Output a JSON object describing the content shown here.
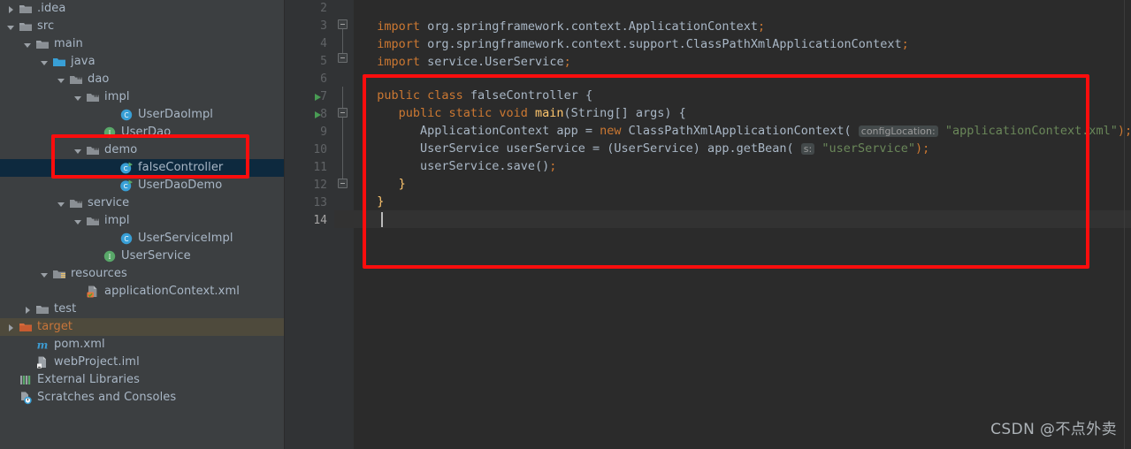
{
  "window": {
    "theme_bg": "#3c3f41",
    "editor_bg": "#2b2b2b",
    "accent_red": "#fb0d0d",
    "selection_bg": "#0d293e",
    "excluded_bg": "#4e4a3c"
  },
  "sidebar": {
    "name": "project-tree",
    "items": [
      {
        "label": ".idea",
        "indent": 0,
        "arrow": "collapsed",
        "icon": "folder-icon",
        "state": "normal"
      },
      {
        "label": "src",
        "indent": 0,
        "arrow": "expanded",
        "icon": "folder-icon",
        "state": "normal"
      },
      {
        "label": "main",
        "indent": 1,
        "arrow": "expanded",
        "icon": "folder-icon",
        "state": "normal"
      },
      {
        "label": "java",
        "indent": 2,
        "arrow": "expanded",
        "icon": "source-root-icon",
        "state": "normal"
      },
      {
        "label": "dao",
        "indent": 3,
        "arrow": "expanded",
        "icon": "package-icon",
        "state": "normal"
      },
      {
        "label": "impl",
        "indent": 4,
        "arrow": "expanded",
        "icon": "package-icon",
        "state": "normal"
      },
      {
        "label": "UserDaoImpl",
        "indent": 6,
        "arrow": "none",
        "icon": "java-class-icon",
        "state": "normal"
      },
      {
        "label": "UserDao",
        "indent": 5,
        "arrow": "none",
        "icon": "java-interface-icon",
        "state": "normal"
      },
      {
        "label": "demo",
        "indent": 4,
        "arrow": "expanded",
        "icon": "package-icon",
        "state": "normal"
      },
      {
        "label": "falseController",
        "indent": 6,
        "arrow": "none",
        "icon": "java-runnable-class-icon",
        "state": "selected"
      },
      {
        "label": "UserDaoDemo",
        "indent": 6,
        "arrow": "none",
        "icon": "java-runnable-class-icon",
        "state": "normal"
      },
      {
        "label": "service",
        "indent": 3,
        "arrow": "expanded",
        "icon": "package-icon",
        "state": "normal"
      },
      {
        "label": "impl",
        "indent": 4,
        "arrow": "expanded",
        "icon": "package-icon",
        "state": "normal"
      },
      {
        "label": "UserServiceImpl",
        "indent": 6,
        "arrow": "none",
        "icon": "java-class-icon",
        "state": "normal"
      },
      {
        "label": "UserService",
        "indent": 5,
        "arrow": "none",
        "icon": "java-interface-icon",
        "state": "normal"
      },
      {
        "label": "resources",
        "indent": 2,
        "arrow": "expanded",
        "icon": "resource-root-icon",
        "state": "normal"
      },
      {
        "label": "applicationContext.xml",
        "indent": 4,
        "arrow": "none",
        "icon": "spring-xml-icon",
        "state": "normal"
      },
      {
        "label": "test",
        "indent": 1,
        "arrow": "collapsed",
        "icon": "folder-icon",
        "state": "normal"
      },
      {
        "label": "target",
        "indent": 0,
        "arrow": "collapsed",
        "icon": "excluded-folder-icon",
        "state": "excluded"
      },
      {
        "label": "pom.xml",
        "indent": 1,
        "arrow": "none",
        "icon": "maven-icon",
        "state": "normal"
      },
      {
        "label": "webProject.iml",
        "indent": 1,
        "arrow": "none",
        "icon": "iml-file-icon",
        "state": "normal"
      },
      {
        "label": "External Libraries",
        "indent": 0,
        "arrow": "none",
        "icon": "libraries-icon",
        "state": "normal"
      },
      {
        "label": "Scratches and Consoles",
        "indent": 0,
        "arrow": "none",
        "icon": "scratches-icon",
        "state": "normal"
      }
    ],
    "highlight_box": {
      "label": "demo-package-and-falseController-highlight"
    }
  },
  "editor": {
    "name": "code-editor",
    "first_visible_line": 2,
    "current_line": 14,
    "line_numbers": [
      2,
      3,
      4,
      5,
      6,
      7,
      8,
      9,
      10,
      11,
      12,
      13,
      14
    ],
    "run_gutter_lines": [
      7,
      8
    ],
    "lines": [
      {
        "n": 2,
        "text": ""
      },
      {
        "n": 3,
        "text": "import org.springframework.context.ApplicationContext;"
      },
      {
        "n": 4,
        "text": "import org.springframework.context.support.ClassPathXmlApplicationContext;"
      },
      {
        "n": 5,
        "text": "import service.UserService;"
      },
      {
        "n": 6,
        "text": ""
      },
      {
        "n": 7,
        "text": "public class falseController {"
      },
      {
        "n": 8,
        "text": "    public static void main(String[] args) {"
      },
      {
        "n": 9,
        "text": "        ApplicationContext app = new ClassPathXmlApplicationContext( configLocation: \"applicationContext.xml\");"
      },
      {
        "n": 10,
        "text": "        UserService userService = (UserService) app.getBean( s: \"userService\");"
      },
      {
        "n": 11,
        "text": "        userService.save();"
      },
      {
        "n": 12,
        "text": "    }"
      },
      {
        "n": 13,
        "text": "}"
      },
      {
        "n": 14,
        "text": ""
      }
    ],
    "tokens": {
      "kw_import": "import",
      "kw_public": "public",
      "kw_class": "class",
      "kw_static": "static",
      "kw_void": "void",
      "kw_new": "new",
      "import_1_pkg": " org.springframework.context.ApplicationContext",
      "import_2_pkg": " org.springframework.context.support.ClassPathXmlApplicationContext",
      "import_3_pkg": " service.UserService",
      "semicolon": ";",
      "class_name": " falseController {",
      "main_name": "main",
      "main_sig": "(String[] args) {",
      "l9_a": "ApplicationContext app = ",
      "l9_b": "ClassPathXmlApplicationContext(",
      "l9_hint": "configLocation:",
      "l9_str": "\"applicationContext.xml\"",
      "l9_end": ");",
      "l10_a": "UserService userService = (UserService) app.getBean(",
      "l10_hint": "s:",
      "l10_str": "\"userService\"",
      "l10_end": ");",
      "l11_a": "userService.save()",
      "l11_end": ";",
      "close_inner": "}",
      "close_outer": "}"
    },
    "highlight_box": {
      "label": "class-body-highlight"
    }
  },
  "watermark": {
    "text": "CSDN @不点外卖"
  }
}
